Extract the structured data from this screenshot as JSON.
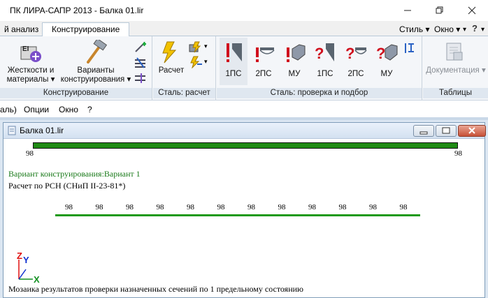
{
  "window": {
    "title": "ПК ЛИРА-САПР  2013 - Балка 01.lir"
  },
  "tabs": {
    "partial_left": "й анализ",
    "active": "Конструирование",
    "right": [
      "Стиль",
      "Окно",
      "?"
    ]
  },
  "ribbon": {
    "groups": [
      {
        "label": "Конструирование",
        "buttons": [
          {
            "label": "Жесткости и материалы"
          },
          {
            "label": "Варианты конструирования"
          }
        ]
      },
      {
        "label": "Сталь: расчет",
        "buttons": [
          {
            "label": "Расчет"
          }
        ]
      },
      {
        "label": "Сталь: проверка и подбор",
        "buttons": [
          {
            "label": "1ПС"
          },
          {
            "label": "2ПС"
          },
          {
            "label": "МУ"
          },
          {
            "label": "1ПС"
          },
          {
            "label": "2ПС"
          },
          {
            "label": "МУ"
          }
        ]
      },
      {
        "label": "Таблицы",
        "buttons": [
          {
            "label": "Документация"
          }
        ]
      }
    ],
    "small_icon_el": "EI"
  },
  "menubar": {
    "items": [
      "аль)",
      "Опции",
      "Окно",
      "?"
    ]
  },
  "child_window": {
    "title": "Балка 01.lir"
  },
  "canvas": {
    "top_bar_left_value": "98",
    "top_bar_right_value": "98",
    "variant_text": "Вариант конструирования:Вариант 1",
    "calc_text": "Расчет по РСН (СНиП II-23-81*)",
    "bottom_bar_values": [
      "98",
      "98",
      "98",
      "98",
      "98",
      "98",
      "98",
      "98",
      "98",
      "98",
      "98",
      "98"
    ],
    "axes": {
      "z": "Z",
      "y": "Y",
      "x": "X"
    },
    "status_text": "Мозаика результатов проверки назначенных сечений по 1 предельному состоянию"
  },
  "colors": {
    "bar_green": "#1f9a14",
    "bar_green_top": "#2f8a10",
    "text_green": "#1a7a1a",
    "axis_z": "#e01010",
    "axis_y": "#1030d0",
    "axis_x": "#109020"
  }
}
